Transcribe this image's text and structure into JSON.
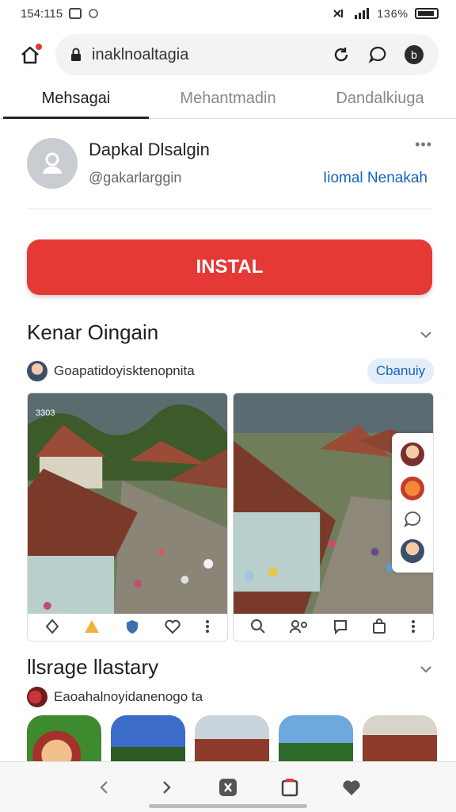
{
  "status": {
    "time": "154:115",
    "battery": "136%"
  },
  "browser": {
    "url": "inaklnoaltagia"
  },
  "tabs": [
    "Mehsagai",
    "Mehantmadin",
    "Dandalkiuga"
  ],
  "profile": {
    "name": "Dapkal Dlsalgin",
    "handle": "@gakarlarggin",
    "more": "•••",
    "link": "Iiomal Nenakah"
  },
  "install_button": "INSTAL",
  "section1": {
    "title": "Kenar Oingain",
    "byline": "Goapatidoyisktenopnita",
    "pill": "Cbanuiy",
    "screenshot_time": "3303"
  },
  "section2": {
    "title": "llsrage llastary",
    "byline": "Eaoahalnoyidanenogo ta"
  },
  "colors": {
    "accent_red": "#e53935",
    "link_blue": "#1565c0"
  }
}
